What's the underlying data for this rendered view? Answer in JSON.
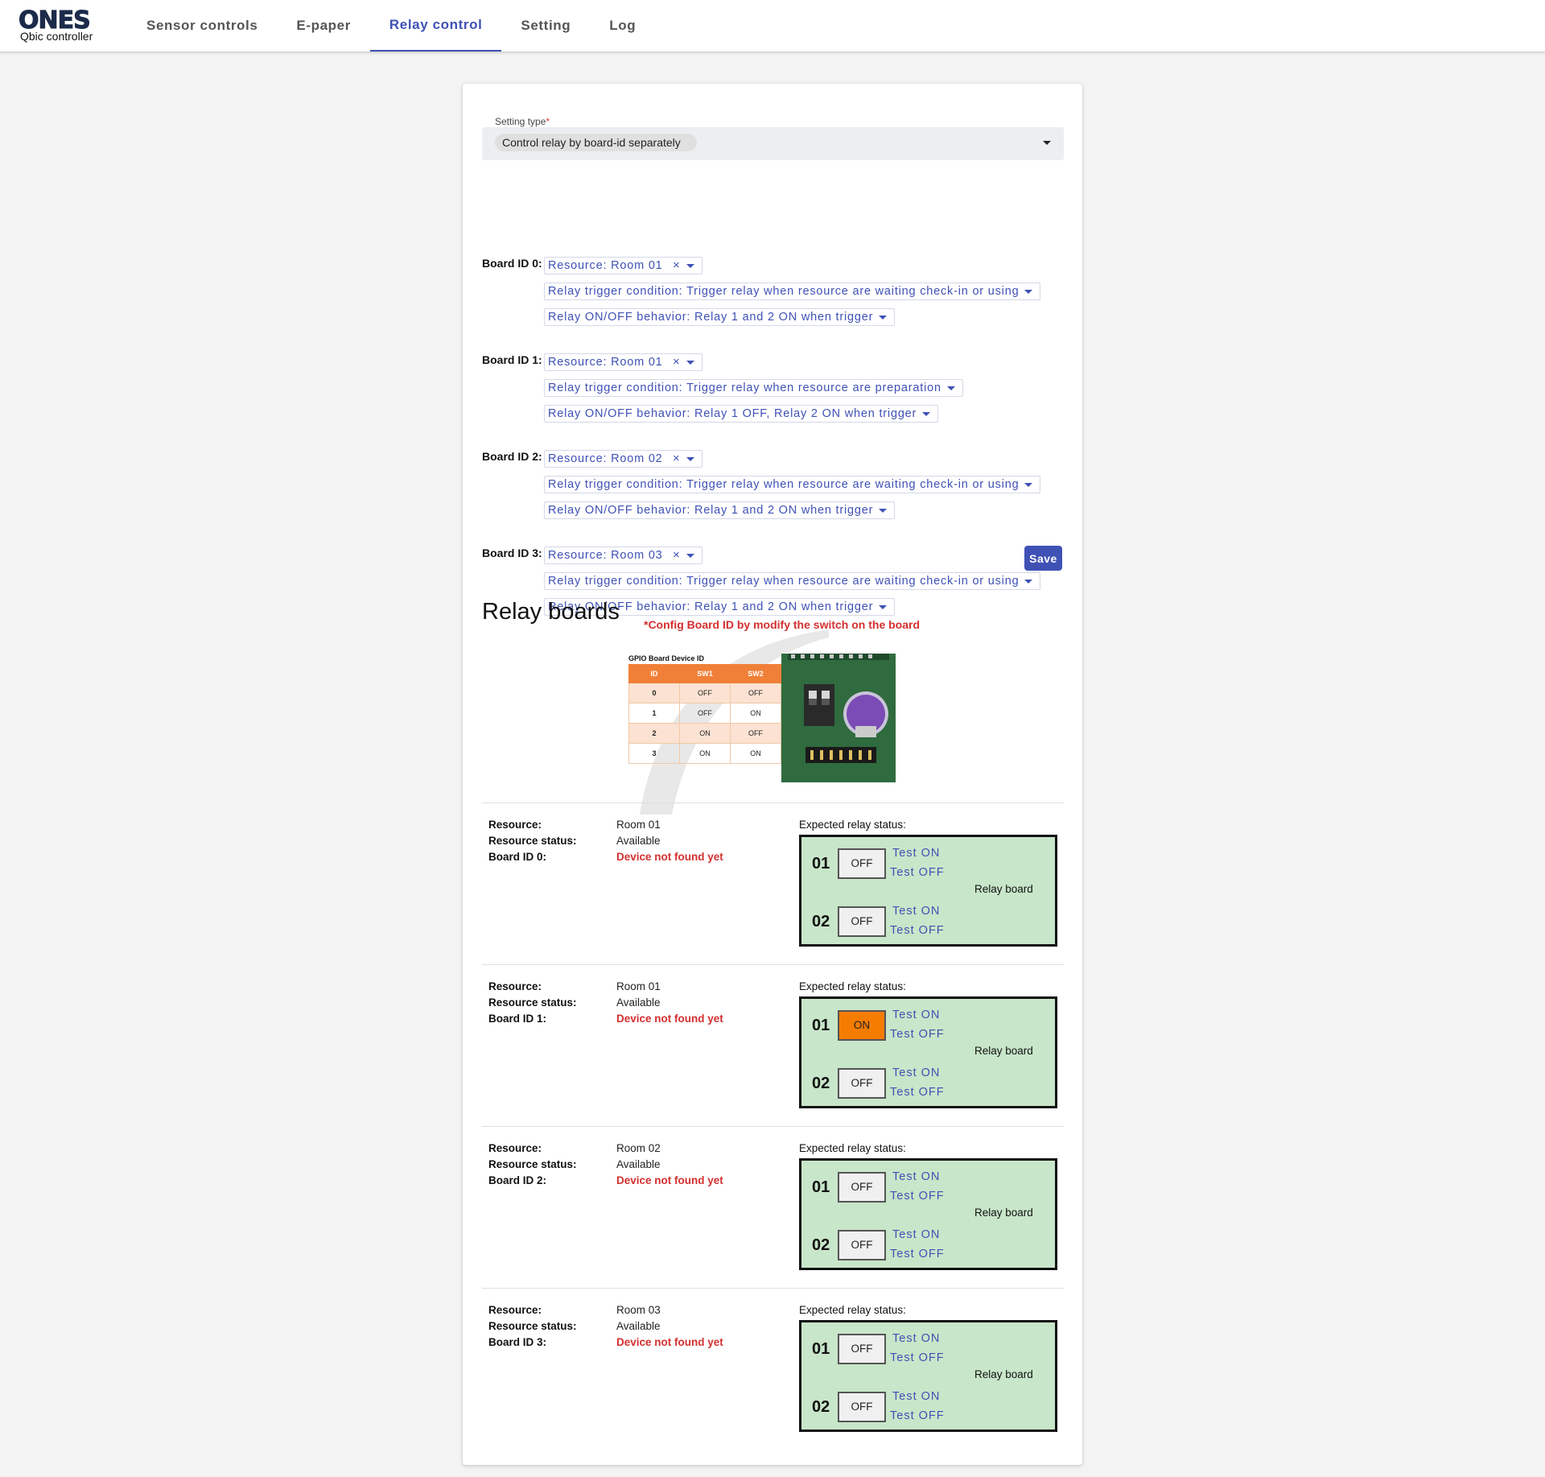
{
  "header": {
    "logo_text": "ONES",
    "logo_subtitle": "Qbic controller",
    "tabs": [
      {
        "label": "Sensor controls",
        "active": false
      },
      {
        "label": "E-paper",
        "active": false
      },
      {
        "label": "Relay control",
        "active": true
      },
      {
        "label": "Setting",
        "active": false
      },
      {
        "label": "Log",
        "active": false
      }
    ]
  },
  "form": {
    "setting_type_label": "Setting type",
    "required_mark": "*",
    "setting_type_value": "Control relay by board-id separately",
    "boards": [
      {
        "label": "Board ID 0:",
        "resource": "Resource: Room 01",
        "trigger": "Relay trigger condition: Trigger relay when resource are waiting check-in or using",
        "behavior": "Relay ON/OFF behavior: Relay 1 and 2 ON when trigger"
      },
      {
        "label": "Board ID 1:",
        "resource": "Resource: Room 01",
        "trigger": "Relay trigger condition: Trigger relay when resource are preparation",
        "behavior": "Relay ON/OFF behavior: Relay 1 OFF, Relay 2 ON when trigger"
      },
      {
        "label": "Board ID 2:",
        "resource": "Resource: Room 02",
        "trigger": "Relay trigger condition: Trigger relay when resource are waiting check-in or using",
        "behavior": "Relay ON/OFF behavior: Relay 1 and 2 ON when trigger"
      },
      {
        "label": "Board ID 3:",
        "resource": "Resource: Room 03",
        "trigger": "Relay trigger condition: Trigger relay when resource are waiting check-in or using",
        "behavior": "Relay ON/OFF behavior: Relay 1 and 2 ON when trigger"
      }
    ],
    "clear_symbol": "×",
    "save_label": "Save"
  },
  "relay_section": {
    "title": "Relay boards",
    "config_note": "*Config Board ID by modify the switch on the board",
    "gpio_table": {
      "title": "GPIO Board Device ID",
      "headers": [
        "ID",
        "SW1",
        "SW2"
      ],
      "rows": [
        [
          "0",
          "OFF",
          "OFF"
        ],
        [
          "1",
          "OFF",
          "ON"
        ],
        [
          "2",
          "ON",
          "OFF"
        ],
        [
          "3",
          "ON",
          "ON"
        ]
      ]
    },
    "labels": {
      "resource": "Resource:",
      "resource_status": "Resource status:",
      "expected": "Expected relay status:",
      "test_on": "Test ON",
      "test_off": "Test OFF",
      "relay_board": "Relay board"
    },
    "boards": [
      {
        "resource": "Room 01",
        "status": "Available",
        "board_label": "Board ID 0:",
        "device": "Device not found yet",
        "relays": [
          {
            "num": "01",
            "state": "OFF"
          },
          {
            "num": "02",
            "state": "OFF"
          }
        ]
      },
      {
        "resource": "Room 01",
        "status": "Available",
        "board_label": "Board ID 1:",
        "device": "Device not found yet",
        "relays": [
          {
            "num": "01",
            "state": "ON"
          },
          {
            "num": "02",
            "state": "OFF"
          }
        ]
      },
      {
        "resource": "Room 02",
        "status": "Available",
        "board_label": "Board ID 2:",
        "device": "Device not found yet",
        "relays": [
          {
            "num": "01",
            "state": "OFF"
          },
          {
            "num": "02",
            "state": "OFF"
          }
        ]
      },
      {
        "resource": "Room 03",
        "status": "Available",
        "board_label": "Board ID 3:",
        "device": "Device not found yet",
        "relays": [
          {
            "num": "01",
            "state": "OFF"
          },
          {
            "num": "02",
            "state": "OFF"
          }
        ]
      }
    ]
  },
  "colors": {
    "accent": "#3f51b5",
    "error": "#d32f2f",
    "relay_on": "#f57c00",
    "relay_board_bg": "#c8e6c9",
    "table_header": "#f08038"
  }
}
